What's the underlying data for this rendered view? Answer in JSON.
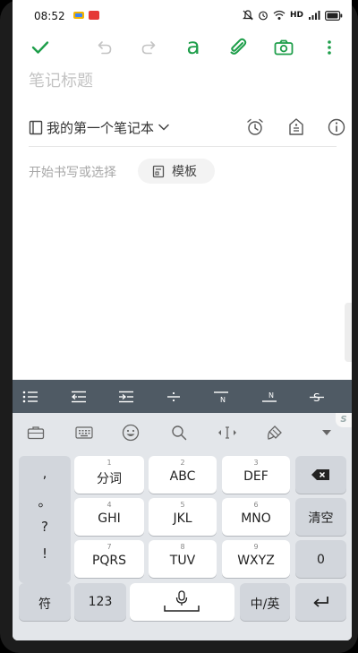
{
  "status_bar": {
    "time": "08:52",
    "network": "HD"
  },
  "toolbar": {
    "font_letter": "a"
  },
  "note": {
    "title_placeholder": "笔记标题",
    "notebook": "我的第一个笔记本",
    "body_placeholder": "开始书写或选择",
    "template_label": "模板"
  },
  "colors": {
    "accent": "#1e9e4a",
    "format_bar": "#4f5a64",
    "keyboard_bg": "#e3e6ea"
  },
  "keyboard": {
    "punctuation": [
      ",",
      "。",
      "?",
      "!"
    ],
    "keys": [
      {
        "num": "1",
        "label": "分词"
      },
      {
        "num": "2",
        "label": "ABC"
      },
      {
        "num": "3",
        "label": "DEF"
      },
      {
        "num": "4",
        "label": "GHI"
      },
      {
        "num": "5",
        "label": "JKL"
      },
      {
        "num": "6",
        "label": "MNO"
      },
      {
        "num": "7",
        "label": "PQRS"
      },
      {
        "num": "8",
        "label": "TUV"
      },
      {
        "num": "9",
        "label": "WXYZ"
      }
    ],
    "clear_label": "清空",
    "zero_label": "0",
    "symbol_label": "符",
    "numeric_label": "123",
    "lang_label": "中/英"
  }
}
